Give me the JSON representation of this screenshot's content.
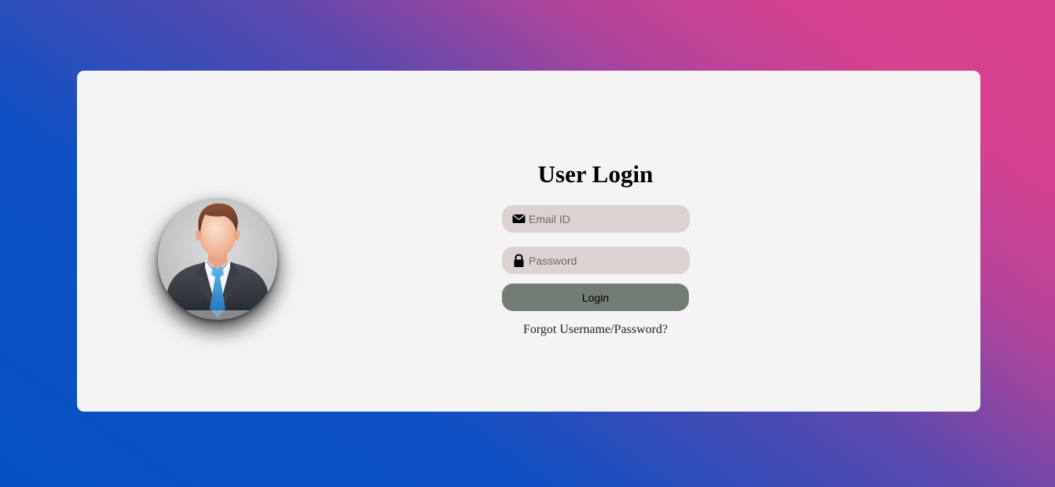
{
  "login": {
    "title": "User Login",
    "email": {
      "placeholder": "Email ID",
      "value": "",
      "icon": "envelope-icon"
    },
    "password": {
      "placeholder": "Password",
      "value": "",
      "icon": "lock-icon"
    },
    "submit_label": "Login",
    "forgot_link": "Forgot Username/Password?"
  },
  "avatar": {
    "icon": "user-avatar-businessman"
  },
  "colors": {
    "card_background": "#f4f4f4",
    "input_background": "#dcd2d2",
    "button_background": "#737d73",
    "gradient_blue": "#0652c5",
    "gradient_pink": "#d8418c"
  }
}
